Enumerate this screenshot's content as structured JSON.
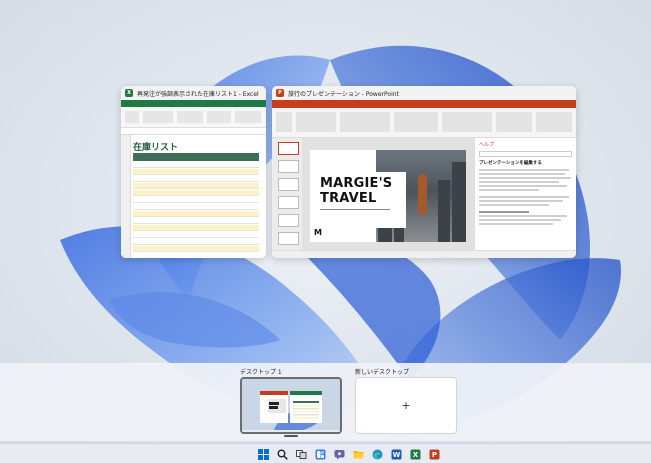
{
  "windows": {
    "excel": {
      "title": "再発注が強調表示された在庫リスト1 - Excel",
      "app_icon": "excel-icon",
      "sheet_title": "在庫リスト",
      "brand_color": "#1f7a45"
    },
    "powerpoint": {
      "title": "旅行のプレゼンテーション - PowerPoint",
      "app_icon": "powerpoint-icon",
      "slide_title_line1": "MARGIE'S",
      "slide_title_line2": "TRAVEL",
      "slide_initial": "M",
      "help_pane_title": "ヘルプ",
      "help_pane_heading": "プレゼンテーションを編集する",
      "brand_color": "#c43e1c"
    }
  },
  "desktops": {
    "desktop_1_label": "デスクトップ 1",
    "new_desktop_label": "新しいデスクトップ",
    "new_desktop_symbol": "+"
  },
  "taskbar": {
    "icons": [
      "start-icon",
      "search-icon",
      "task-view-icon",
      "widgets-icon",
      "chat-icon",
      "file-explorer-icon",
      "edge-icon",
      "word-icon",
      "excel-icon",
      "powerpoint-icon"
    ]
  }
}
